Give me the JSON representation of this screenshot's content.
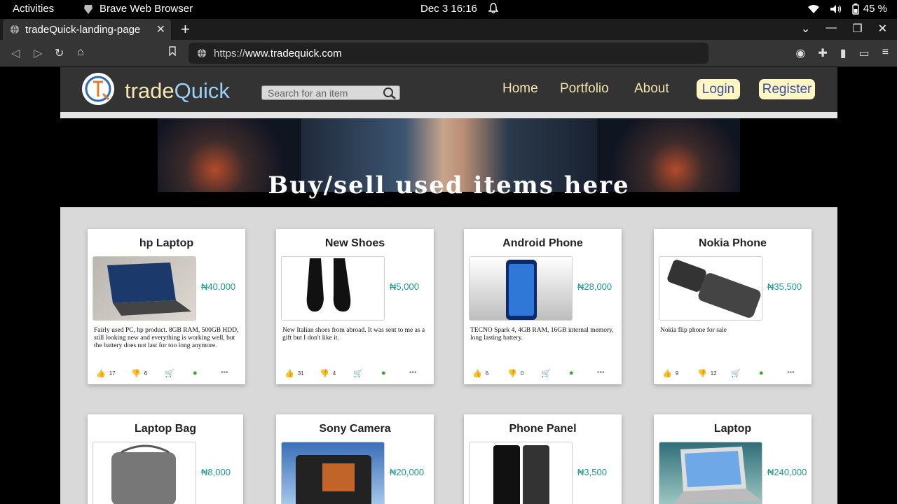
{
  "system": {
    "activities": "Activities",
    "app_name": "Brave Web Browser",
    "clock": "Dec 3  16:16",
    "battery": "45 %"
  },
  "browser": {
    "tab_title": "tradeQuick-landing-page",
    "url_scheme": "https://",
    "url_host": "www.tradequick.com"
  },
  "site": {
    "brand_first": "trade",
    "brand_second": "Quick",
    "search_placeholder": "Search for an item",
    "nav": [
      "Home",
      "Portfolio",
      "About"
    ],
    "login": "Login",
    "register": "Register",
    "banner_text": "Buy/sell used items here",
    "colors": {
      "header": "#333333",
      "nav_text": "#f5e6b0",
      "price": "#1a9a8a",
      "pill": "#fff6c2"
    }
  },
  "products": [
    {
      "title": "hp Laptop",
      "price": "₦40,000",
      "desc": "Fairly used PC, hp product. 8GB RAM, 500GB HDD, still looking new and everything is working well, but the battery does not last for too long anymore.",
      "likes": "17",
      "dislikes": "6"
    },
    {
      "title": "New Shoes",
      "price": "₦5,000",
      "desc": "New Italian shoes from abroad. It was sent to me as a gift but I don't like it.",
      "likes": "31",
      "dislikes": "4"
    },
    {
      "title": "Android Phone",
      "price": "₦28,000",
      "desc": "TECNO Spark 4, 4GB RAM, 16GB internal memory, long lasting battery.",
      "likes": "6",
      "dislikes": "0"
    },
    {
      "title": "Nokia Phone",
      "price": "₦35,500",
      "desc": "Nokia flip phone for sale",
      "likes": "9",
      "dislikes": "12"
    },
    {
      "title": "Laptop Bag",
      "price": "₦8,000",
      "desc": "",
      "likes": "",
      "dislikes": ""
    },
    {
      "title": "Sony Camera",
      "price": "₦20,000",
      "desc": "",
      "likes": "",
      "dislikes": ""
    },
    {
      "title": "Phone Panel",
      "price": "₦3,500",
      "desc": "",
      "likes": "",
      "dislikes": ""
    },
    {
      "title": "Laptop",
      "price": "₦240,000",
      "desc": "",
      "likes": "",
      "dislikes": ""
    }
  ]
}
